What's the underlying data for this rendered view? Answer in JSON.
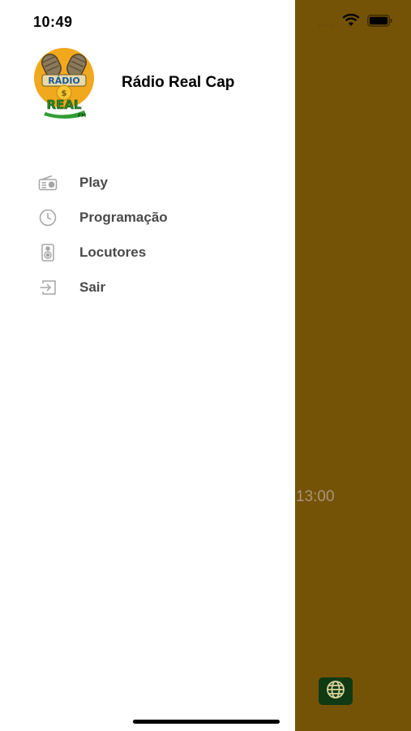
{
  "status_bar": {
    "time": "10:49",
    "signal": "....",
    "wifi_icon": "wifi-icon",
    "battery_icon": "battery-icon"
  },
  "drawer": {
    "title": "Rádio Real Cap",
    "logo_icon": "radio-real-logo",
    "items": [
      {
        "label": "Play",
        "icon": "radio-icon"
      },
      {
        "label": "Programação",
        "icon": "clock-icon"
      },
      {
        "label": "Locutores",
        "icon": "speaker-icon"
      },
      {
        "label": "Sair",
        "icon": "logout-icon"
      }
    ]
  },
  "background": {
    "color": "#755306",
    "time_text": "13:00",
    "globe_button_icon": "globe-icon",
    "globe_button_color": "#0f3a14"
  }
}
